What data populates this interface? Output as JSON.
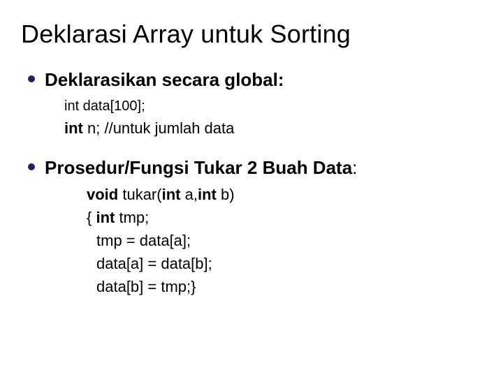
{
  "title": "Deklarasi Array untuk Sorting",
  "section1": {
    "heading": "Deklarasikan secara global:",
    "line1": "int data[100];",
    "line2_kw": "int",
    "line2_rest": " n; //untuk jumlah data"
  },
  "section2": {
    "heading": "Prosedur/Fungsi Tukar 2 Buah Data",
    "l1_kw1": "void",
    "l1_mid": " tukar(",
    "l1_kw2": "int",
    "l1_mid2": " a,",
    "l1_kw3": "int",
    "l1_end": " b)",
    "l2_open": "{ ",
    "l2_kw": "int",
    "l2_rest": " tmp;",
    "l3": "tmp = data[a];",
    "l4": "data[a] = data[b];",
    "l5": "data[b] = tmp;}"
  }
}
